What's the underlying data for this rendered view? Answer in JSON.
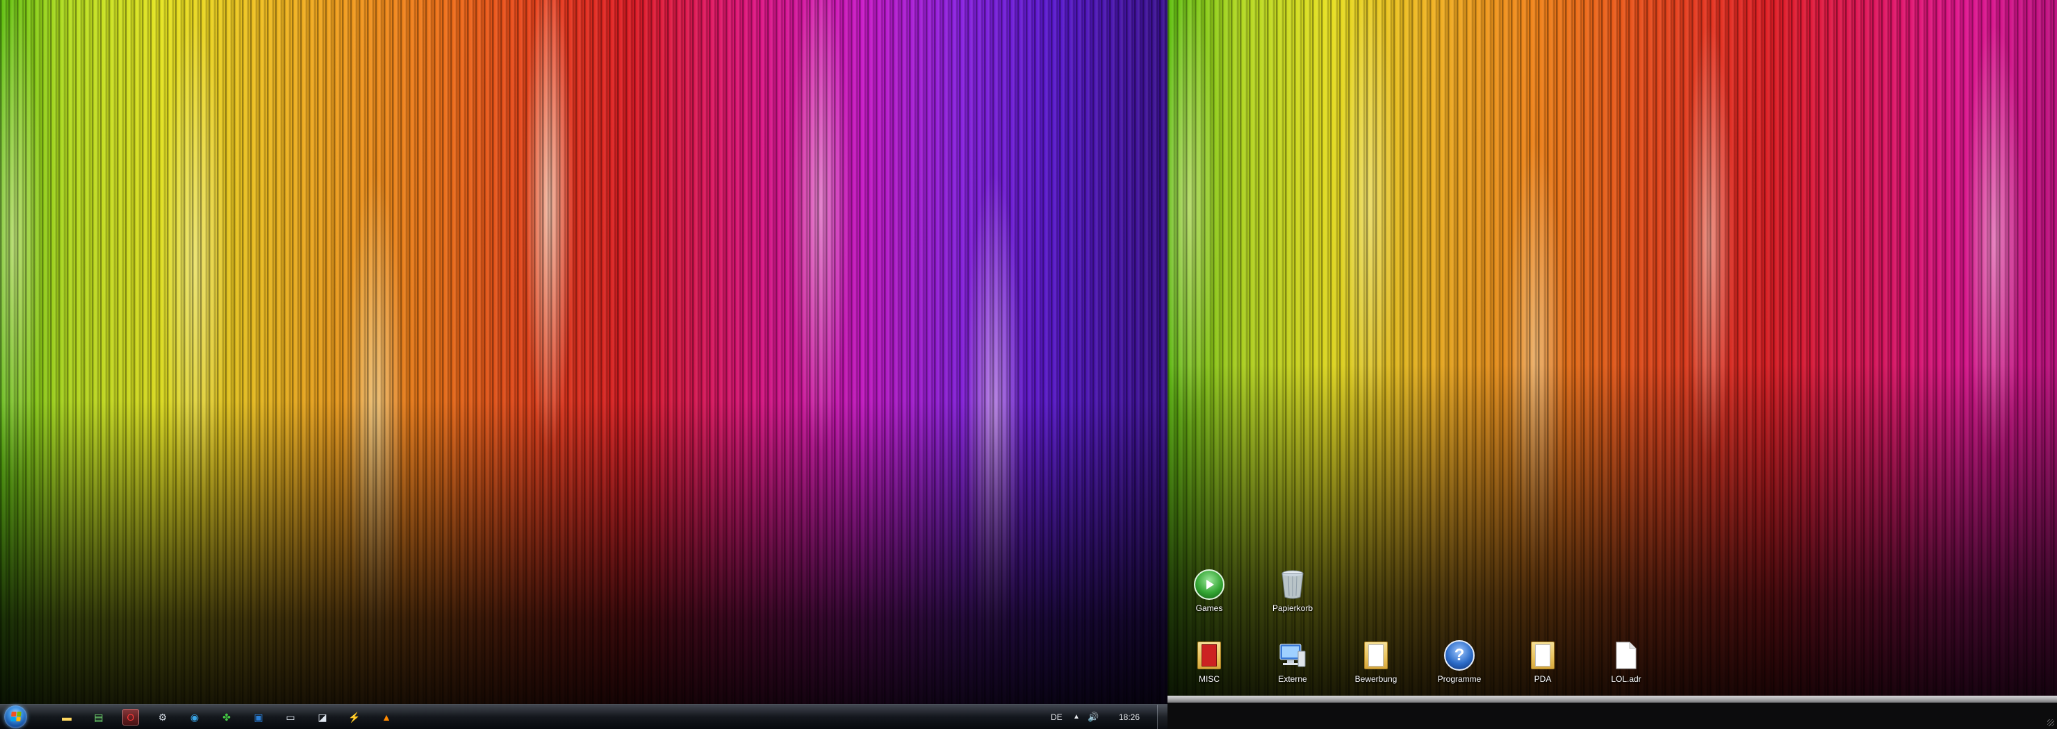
{
  "left_taskbar": {
    "pinned": [
      {
        "name": "explorer-icon",
        "glyph": "▬",
        "color": "#ffd860"
      },
      {
        "name": "green-app-icon",
        "glyph": "▤",
        "color": "#6ed36e"
      },
      {
        "name": "opera-icon",
        "glyph": "O",
        "color": "#ff3a3a",
        "active": true
      },
      {
        "name": "steam-icon",
        "glyph": "⚙",
        "color": "#dfe6ef"
      },
      {
        "name": "skype-icon",
        "glyph": "◉",
        "color": "#3aa6e8"
      },
      {
        "name": "clover-icon",
        "glyph": "✤",
        "color": "#43c843"
      },
      {
        "name": "document-app-icon",
        "glyph": "▣",
        "color": "#2a7fd8"
      },
      {
        "name": "window-app-icon",
        "glyph": "▭",
        "color": "#dfe6ef"
      },
      {
        "name": "tool-app-icon",
        "glyph": "◪",
        "color": "#dfe6ef"
      },
      {
        "name": "lightning-app-icon",
        "glyph": "⚡",
        "color": "#f0c040"
      },
      {
        "name": "vlc-icon",
        "glyph": "▲",
        "color": "#ff8a00"
      }
    ],
    "tray": {
      "language": "DE",
      "clock": "18:26",
      "arrow": "▲",
      "volume": "🔊"
    }
  },
  "desktop_icons": [
    {
      "name": "desktop-icon-games",
      "label": "Games",
      "type": "play",
      "color": "#34a634"
    },
    {
      "name": "desktop-icon-papierkorb",
      "label": "Papierkorb",
      "type": "bin",
      "color": "#c7d3dd"
    },
    {
      "name": "desktop-icon-misc",
      "label": "MISC",
      "type": "folder",
      "color": "#cc2222"
    },
    {
      "name": "desktop-icon-externe",
      "label": "Externe",
      "type": "computer",
      "color": "#3a7ad8"
    },
    {
      "name": "desktop-icon-bewerbung",
      "label": "Bewerbung",
      "type": "folder",
      "color": "#e9c25c"
    },
    {
      "name": "desktop-icon-programme",
      "label": "Programme",
      "type": "help",
      "color": "#2c6cc8"
    },
    {
      "name": "desktop-icon-pda",
      "label": "PDA",
      "type": "folder",
      "color": "#e9c25c"
    },
    {
      "name": "desktop-icon-lol-adr",
      "label": "LOL.adr",
      "type": "file",
      "color": "#ffffff"
    }
  ]
}
